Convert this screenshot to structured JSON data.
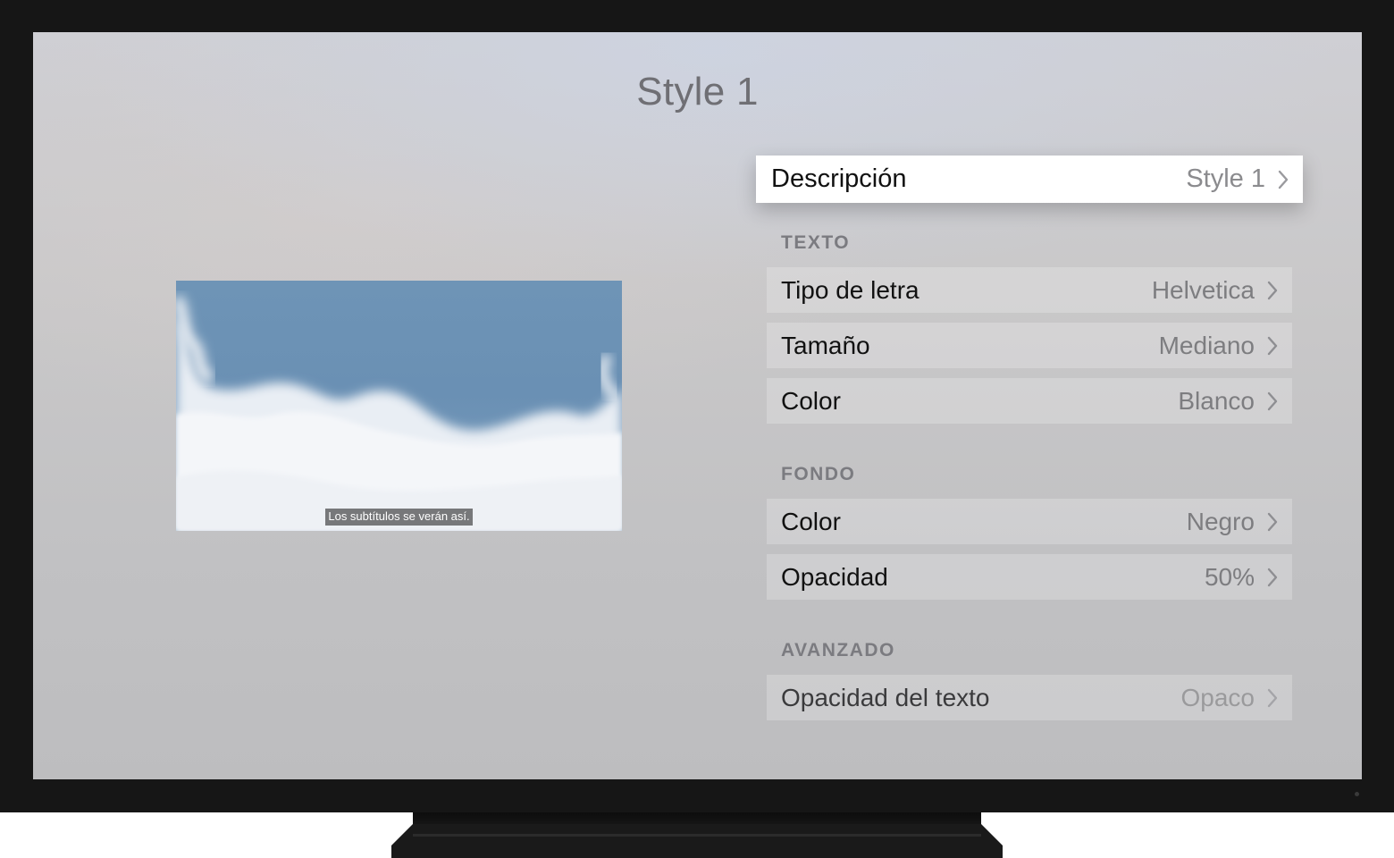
{
  "title": "Style 1",
  "preview": {
    "subtitle_sample": "Los subtítulos se verán así."
  },
  "description_row": {
    "label": "Descripción",
    "value": "Style 1"
  },
  "sections": {
    "text": {
      "header": "TEXTO",
      "rows": [
        {
          "label": "Tipo de letra",
          "value": "Helvetica"
        },
        {
          "label": "Tamaño",
          "value": "Mediano"
        },
        {
          "label": "Color",
          "value": "Blanco"
        }
      ]
    },
    "background": {
      "header": "FONDO",
      "rows": [
        {
          "label": "Color",
          "value": "Negro"
        },
        {
          "label": "Opacidad",
          "value": "50%"
        }
      ]
    },
    "advanced": {
      "header": "AVANZADO",
      "rows": [
        {
          "label": "Opacidad del texto",
          "value": "Opaco"
        }
      ]
    }
  },
  "icons": {
    "row_chevron": "chevron-right-icon"
  },
  "colors": {
    "focused_row": "#ffffff",
    "tv_bezel": "#161616",
    "preview_sky": "#6e94b6"
  }
}
